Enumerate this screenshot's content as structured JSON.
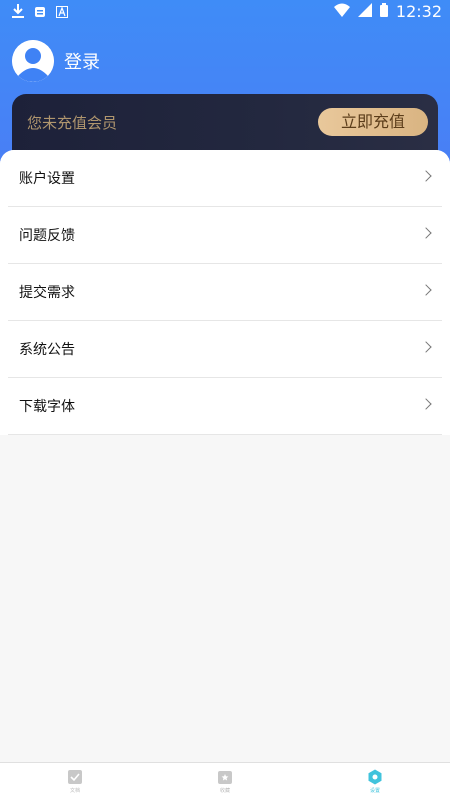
{
  "status_bar": {
    "time": "12:32",
    "icons": [
      "download-icon",
      "sim-icon",
      "font-icon",
      "wifi-icon",
      "signal-icon",
      "battery-icon"
    ]
  },
  "profile": {
    "login_label": "登录"
  },
  "vip_card": {
    "message": "您未充值会员",
    "button_label": "立即充值"
  },
  "menu": {
    "items": [
      {
        "label": "账户设置"
      },
      {
        "label": "问题反馈"
      },
      {
        "label": "提交需求"
      },
      {
        "label": "系统公告"
      },
      {
        "label": "下载字体"
      }
    ]
  },
  "bottom_nav": {
    "items": [
      {
        "label": "文档",
        "icon": "document-icon"
      },
      {
        "label": "收藏",
        "icon": "favorite-icon"
      },
      {
        "label": "设置",
        "icon": "settings-icon"
      }
    ],
    "active_color": "#40c3dc"
  },
  "colors": {
    "header_gradient_start": "#3f8cf7",
    "header_gradient_end": "#4a7ef5",
    "vip_text": "#b0966e",
    "vip_button": "#e9c89b"
  }
}
